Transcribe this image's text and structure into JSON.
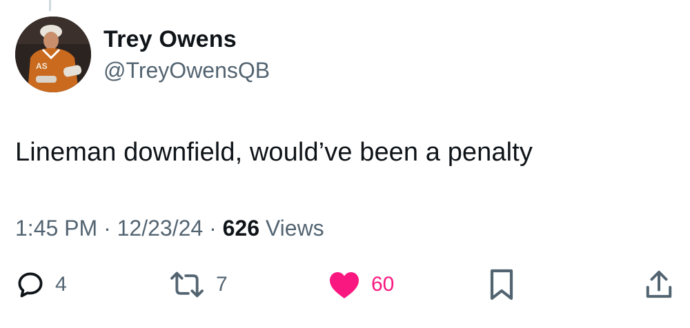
{
  "tweet": {
    "author_name": "Trey Owens",
    "author_handle": "@TreyOwensQB",
    "text": "Lineman downfield, would’ve been a penalty",
    "time": "1:45 PM",
    "date": "12/23/24",
    "separator": "·",
    "views_count": "626",
    "views_label": "Views",
    "jersey_lettering": "AS"
  },
  "actions": {
    "reply_count": "4",
    "retweet_count": "7",
    "like_count": "60",
    "liked": true
  },
  "colors": {
    "text_primary": "#0f1419",
    "text_secondary": "#536471",
    "like_active": "#f91880",
    "thread_line": "#cfd9de"
  },
  "icons": [
    "reply-icon",
    "retweet-icon",
    "heart-icon",
    "bookmark-icon",
    "share-icon"
  ]
}
